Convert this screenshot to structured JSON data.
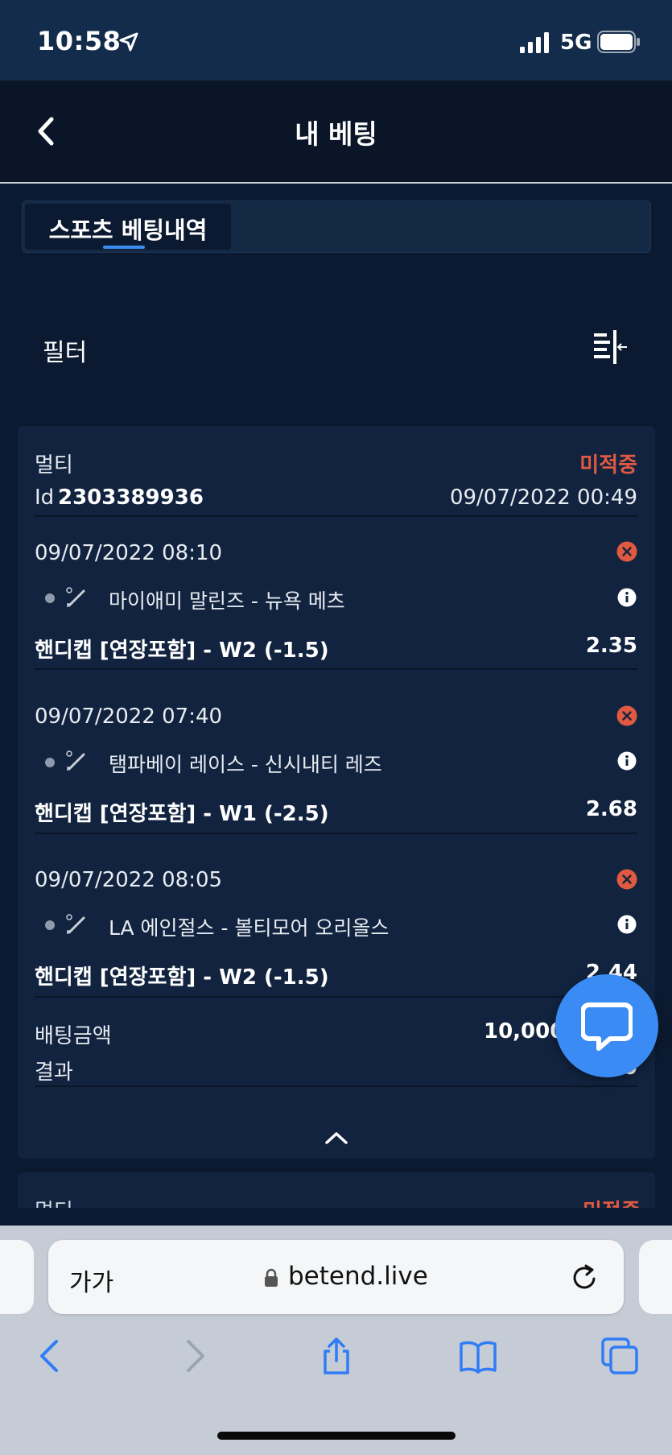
{
  "status_bar": {
    "time": "10:58",
    "network": "5G"
  },
  "header": {
    "title": "내 베팅"
  },
  "tabs": [
    {
      "label": "스포츠 베팅내역",
      "active": true
    }
  ],
  "filter": {
    "label": "필터"
  },
  "bet": {
    "type": "멀티",
    "status": "미적중",
    "id_prefix": "Id",
    "id": "2303389936",
    "placed_at": "09/07/2022 00:49",
    "selections": [
      {
        "time": "09/07/2022 08:10",
        "match": "마이애미 말린즈 - 뉴욕 메츠",
        "market": "핸디캡 [연장포함] - W2 (-1.5)",
        "odds": "2.35"
      },
      {
        "time": "09/07/2022 07:40",
        "match": "탬파베이 레이스 - 신시내티 레즈",
        "market": "핸디캡 [연장포함] - W1 (-2.5)",
        "odds": "2.68"
      },
      {
        "time": "09/07/2022 08:05",
        "match": "LA 에인절스 - 볼티모어 오리올스",
        "market": "핸디캡 [연장포함] - W2 (-1.5)",
        "odds": "2.44"
      }
    ],
    "stake_label": "배팅금액",
    "stake_value": "10,000",
    "result_label": "결과",
    "result_value": "0"
  },
  "next_bet": {
    "type": "멀티",
    "status": "미적중"
  },
  "browser": {
    "text_size_label": "가가",
    "url": "betend.live"
  },
  "colors": {
    "accent": "#3a8cf0",
    "lost": "#e05a42",
    "card": "#11233e",
    "background": "#0b1a30"
  }
}
